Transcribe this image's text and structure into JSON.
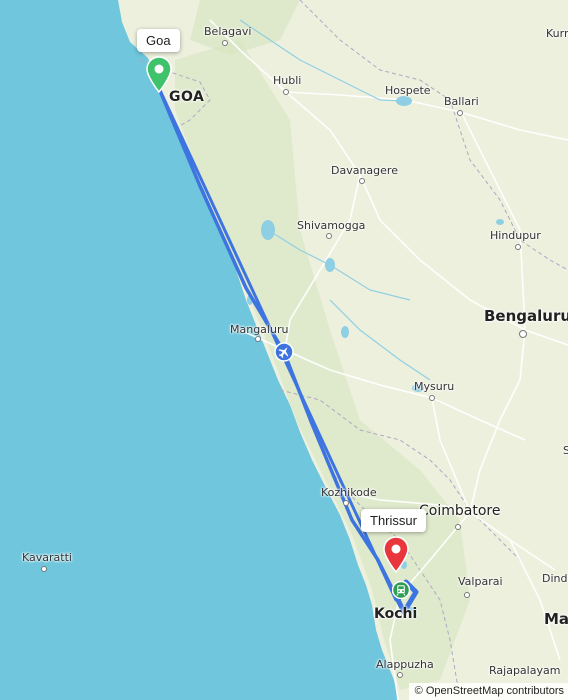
{
  "map": {
    "colors": {
      "sea": "#6fc6dd",
      "land": "#eef0de",
      "route": "#3d74e0",
      "origin_pin": "#3ec26a",
      "destination_pin": "#e8363c"
    },
    "state_labels": {
      "goa": "GOA"
    },
    "cities": {
      "belagavi": "Belagavi",
      "hubli": "Hubli",
      "hospete": "Hospete",
      "ballari": "Ballari",
      "kurnool": "Kurr",
      "davanagere": "Davanagere",
      "shivamogga": "Shivamogga",
      "hindupur": "Hindupur",
      "bengaluru": "Bengaluru",
      "mangaluru": "Mangaluru",
      "mysuru": "Mysuru",
      "kozhikode": "Kozhikode",
      "coimbatore": "Coimbatore",
      "valparai": "Valparai",
      "dindigul": "Dindi",
      "kochi": "Kochi",
      "madurai": "Ma",
      "alappuzha": "Alappuzha",
      "rajapalayam": "Rajapalayam",
      "kavaratti": "Kavaratti",
      "edge_s": "S"
    },
    "origin": {
      "label": "Goa",
      "icon": "green-location-pin-icon"
    },
    "destination": {
      "label": "Thrissur",
      "icon": "red-location-pin-icon"
    },
    "via_icon": "airplane-icon",
    "station_icon": "train-icon",
    "attribution": "© OpenStreetMap contributors"
  }
}
